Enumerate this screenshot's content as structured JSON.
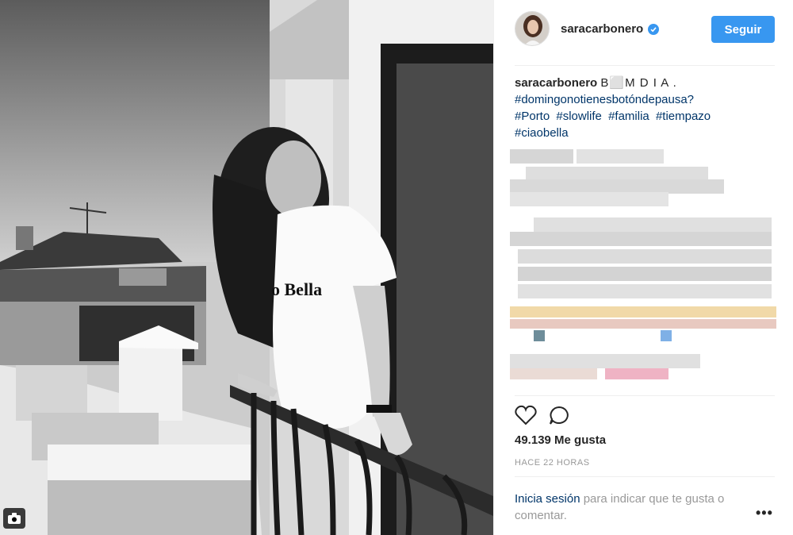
{
  "post": {
    "username": "saracarbonero",
    "follow_label": "Seguir",
    "caption_user": "saracarbonero",
    "caption_text": "B⬜M D I A .",
    "hashtag_line1": "#domingonotienesbotóndepausa?",
    "hashtags_line2": [
      "#Porto",
      "#slowlife",
      "#familia",
      "#tiempazo"
    ],
    "hashtag_line3": "#ciaobella",
    "likes": "49.139 Me gusta",
    "timestamp": "HACE 22 HORAS",
    "login_link": "Inicia sesión",
    "login_text": " para indicar que te gusta o comentar.",
    "more_label": "•••"
  },
  "photo": {
    "shirt_text": "o Bella",
    "icons": [
      "camera-icon"
    ]
  },
  "icons": [
    "heart-icon",
    "comment-icon",
    "verified-icon",
    "more-icon"
  ],
  "colors": {
    "accent": "#3897f0",
    "link": "#003569",
    "muted": "#999999",
    "text": "#262626"
  }
}
